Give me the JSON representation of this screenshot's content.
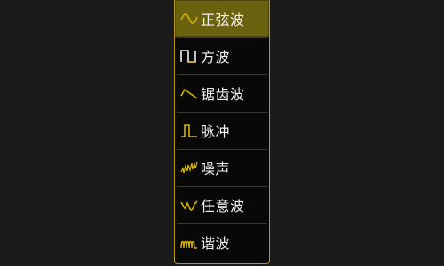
{
  "accent_color": "#d4b300",
  "menu": {
    "items": [
      {
        "label": "正弦波",
        "icon": "sine-wave-icon",
        "selected": true
      },
      {
        "label": "方波",
        "icon": "square-wave-icon",
        "selected": false
      },
      {
        "label": "锯齿波",
        "icon": "sawtooth-wave-icon",
        "selected": false
      },
      {
        "label": "脉冲",
        "icon": "pulse-wave-icon",
        "selected": false
      },
      {
        "label": "噪声",
        "icon": "noise-wave-icon",
        "selected": false
      },
      {
        "label": "任意波",
        "icon": "arbitrary-wave-icon",
        "selected": false
      },
      {
        "label": "谐波",
        "icon": "harmonic-wave-icon",
        "selected": false
      }
    ]
  }
}
